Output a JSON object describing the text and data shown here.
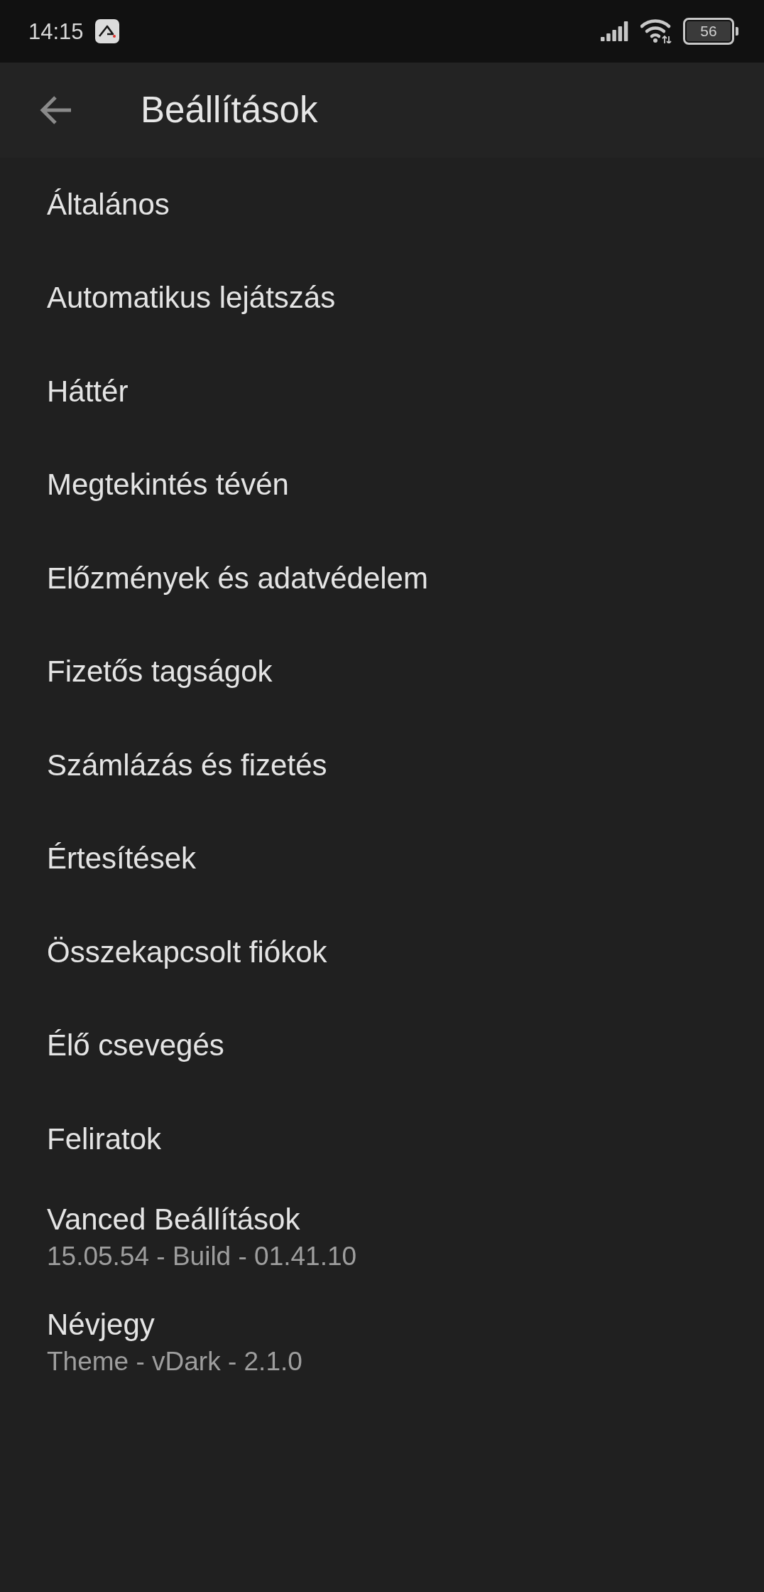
{
  "status_bar": {
    "time": "14:15",
    "battery": "56"
  },
  "toolbar": {
    "title": "Beállítások"
  },
  "settings_items": [
    {
      "title": "Általános"
    },
    {
      "title": "Automatikus lejátszás"
    },
    {
      "title": "Háttér"
    },
    {
      "title": "Megtekintés tévén"
    },
    {
      "title": "Előzmények és adatvédelem"
    },
    {
      "title": "Fizetős tagságok"
    },
    {
      "title": "Számlázás és fizetés"
    },
    {
      "title": "Értesítések"
    },
    {
      "title": "Összekapcsolt fiókok"
    },
    {
      "title": "Élő csevegés"
    },
    {
      "title": "Feliratok"
    },
    {
      "title": "Vanced Beállítások",
      "subtitle": "15.05.54 - Build - 01.41.10"
    },
    {
      "title": "Névjegy",
      "subtitle": "Theme - vDark - 2.1.0"
    }
  ]
}
